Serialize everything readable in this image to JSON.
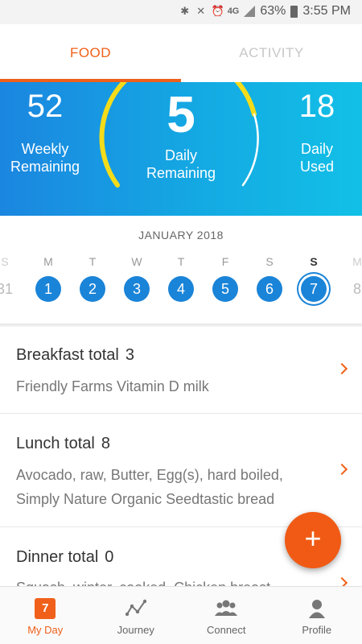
{
  "status_bar": {
    "network": "4G",
    "battery_percent": "63%",
    "time": "3:55 PM"
  },
  "tabs": [
    {
      "label": "FOOD",
      "active": true
    },
    {
      "label": "ACTIVITY",
      "active": false
    }
  ],
  "summary": {
    "weekly_remaining": {
      "value": "52",
      "label_line1": "Weekly",
      "label_line2": "Remaining"
    },
    "daily_remaining": {
      "value": "5",
      "label_line1": "Daily",
      "label_line2": "Remaining"
    },
    "daily_used": {
      "value": "18",
      "label_line1": "Daily",
      "label_line2": "Used"
    }
  },
  "calendar": {
    "month": "JANUARY 2018",
    "days": [
      {
        "letter": "S",
        "num": "31",
        "faded": true
      },
      {
        "letter": "M",
        "num": "1"
      },
      {
        "letter": "T",
        "num": "2"
      },
      {
        "letter": "W",
        "num": "3"
      },
      {
        "letter": "T",
        "num": "4"
      },
      {
        "letter": "F",
        "num": "5"
      },
      {
        "letter": "S",
        "num": "6"
      },
      {
        "letter": "S",
        "num": "7",
        "selected": true
      },
      {
        "letter": "M",
        "num": "8",
        "faded": true
      }
    ]
  },
  "meals": [
    {
      "title": "Breakfast total",
      "value": "3",
      "items": "Friendly Farms Vitamin D milk"
    },
    {
      "title": "Lunch total",
      "value": "8",
      "items": "Avocado, raw, Butter, Egg(s), hard boiled, Simply Nature Organic Seedtastic bread"
    },
    {
      "title": "Dinner total",
      "value": "0",
      "items": "Squash, winter, cooked, Chicken breast"
    }
  ],
  "fab_label": "+",
  "bottom_nav": [
    {
      "label": "My Day",
      "icon": "calendar-icon",
      "badge": "7",
      "active": true
    },
    {
      "label": "Journey",
      "icon": "journey-chart-icon"
    },
    {
      "label": "Connect",
      "icon": "people-icon"
    },
    {
      "label": "Profile",
      "icon": "person-icon"
    }
  ],
  "colors": {
    "accent": "#f0601a",
    "hero_blue": "#1b86e0",
    "hero_cyan": "#12c0e6",
    "arc_yellow": "#f5dc1a",
    "day_blue": "#1a84d8"
  }
}
